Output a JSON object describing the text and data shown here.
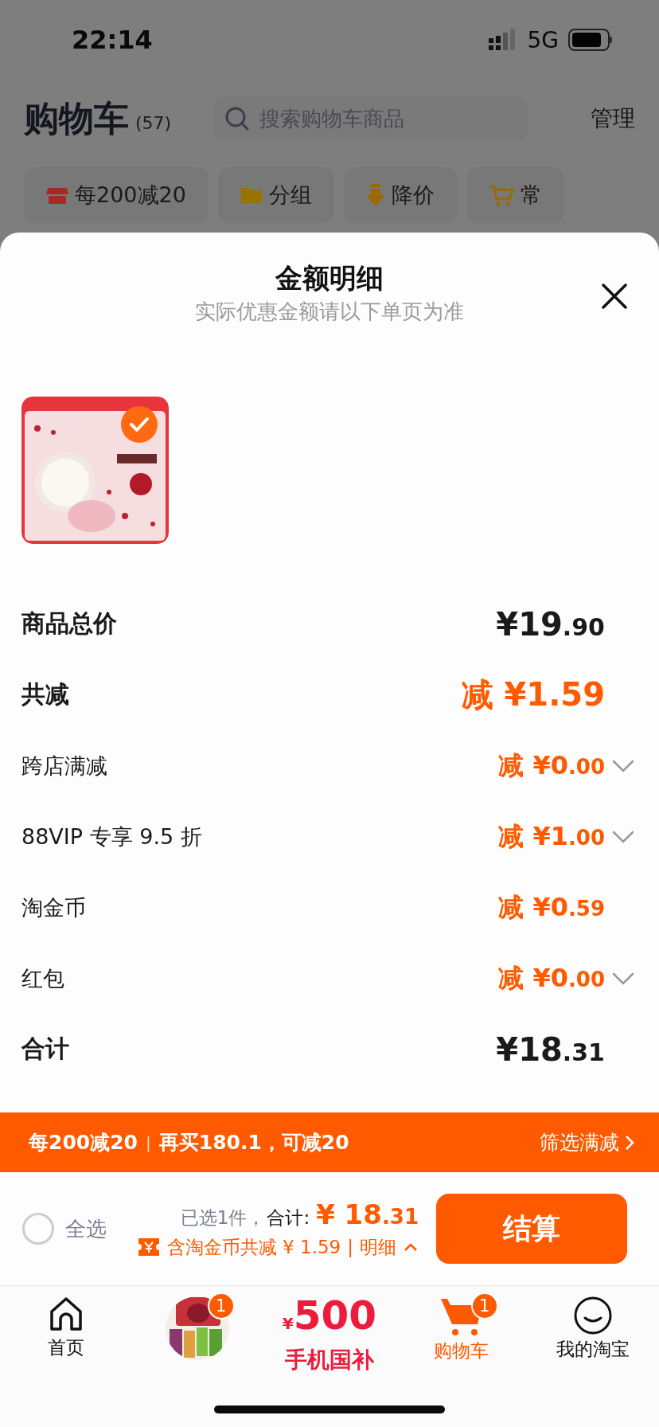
{
  "status_bar": {
    "time": "22:14",
    "network": "5G"
  },
  "header": {
    "title": "购物车",
    "count": "(57)",
    "search": {
      "placeholder": "搜索购物车商品"
    },
    "manage": "管理"
  },
  "chips": [
    {
      "kind": "shop",
      "label": "每200减20"
    },
    {
      "kind": "folder",
      "label": "分组"
    },
    {
      "kind": "down",
      "label": "降价"
    },
    {
      "kind": "cart",
      "label": "常"
    }
  ],
  "sheet": {
    "title": "金额明细",
    "subtitle": "实际优惠金额请以下单页为准",
    "product": {
      "kind": "picture",
      "selected": true
    },
    "rows": [
      {
        "kind": "strong",
        "label": "商品总价",
        "amount_main": "¥19",
        "amount_cents": ".90",
        "highlight": false,
        "has_dropdown": false
      },
      {
        "kind": "strong",
        "label": "共减",
        "prefix": "减",
        "amount_main": "¥1.59",
        "highlight": true,
        "has_dropdown": false
      },
      {
        "kind": "sub",
        "label": "跨店满减",
        "prefix": "减",
        "amount_main": "¥0",
        "amount_cents": ".00",
        "highlight": true,
        "has_dropdown": true
      },
      {
        "kind": "sub",
        "label": "88VIP 专享 9.5 折",
        "prefix": "减",
        "amount_main": "¥1",
        "amount_cents": ".00",
        "highlight": true,
        "has_dropdown": true
      },
      {
        "kind": "sub",
        "label": "淘金币",
        "prefix": "减",
        "amount_main": "¥0",
        "amount_cents": ".59",
        "highlight": true,
        "has_dropdown": false
      },
      {
        "kind": "sub",
        "label": "红包",
        "prefix": "减",
        "amount_main": "¥0",
        "amount_cents": ".00",
        "highlight": true,
        "has_dropdown": true
      },
      {
        "kind": "strong",
        "label": "合计",
        "amount_main": "¥18",
        "amount_cents": ".31",
        "highlight": false,
        "has_dropdown": false
      }
    ]
  },
  "promo_banner": {
    "deal": "每200减20",
    "divider": "|",
    "hint": "再买180.1，可减20",
    "link": "筛选满减"
  },
  "checkout": {
    "select_all": {
      "label": "全选",
      "checked": false
    },
    "selected_count": "已选1件，",
    "total_label": "合计:",
    "total_main": "¥ 18",
    "total_cents": ".31",
    "savings": "含淘金币共减 ¥ 1.59",
    "divider": "|",
    "details": "明细",
    "button": "结算"
  },
  "tab_bar": [
    {
      "kind": "home",
      "label": "首页",
      "selected": false
    },
    {
      "kind": "thumb",
      "badge": "1",
      "selected": false
    },
    {
      "kind": "promo",
      "currency": "¥",
      "amount": "500",
      "label": "手机国补",
      "selected": false
    },
    {
      "kind": "cart",
      "label": "购物车",
      "badge": "1",
      "selected": true
    },
    {
      "kind": "me",
      "label": "我的淘宝",
      "selected": false
    }
  ]
}
